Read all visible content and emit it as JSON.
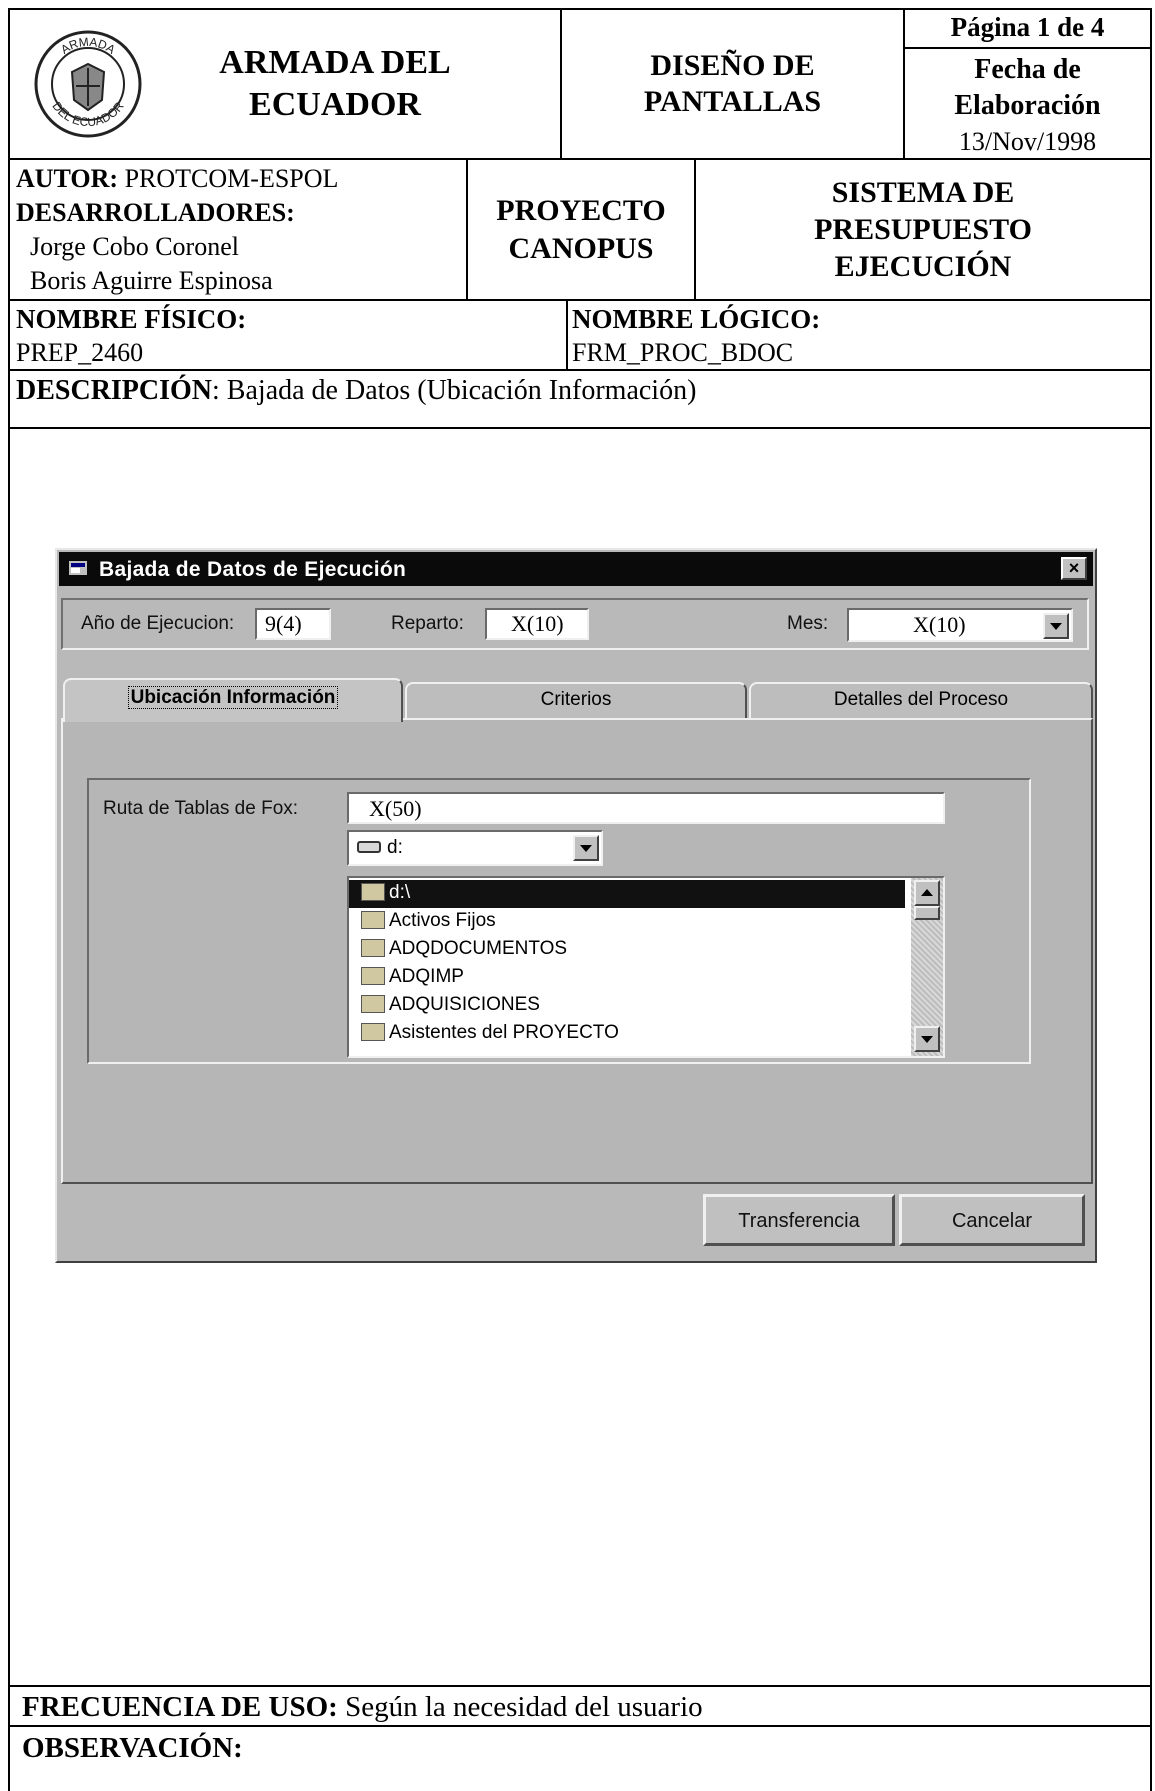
{
  "header": {
    "org_line1": "ARMADA DEL",
    "org_line2": "ECUADOR",
    "seal_top": "ARMADA",
    "seal_bottom": "DEL ECUADOR",
    "doc_type_line1": "DISEÑO DE",
    "doc_type_line2": "PANTALLAS",
    "page": "Página 1 de 4",
    "date_label_line1": "Fecha de",
    "date_label_line2": "Elaboración",
    "date": "13/Nov/1998"
  },
  "authors": {
    "author_label": "AUTOR:",
    "author": "PROTCOM-ESPOL",
    "dev_label": "DESARROLLADORES:",
    "dev1": "Jorge Cobo Coronel",
    "dev2": "Boris Aguirre Espinosa"
  },
  "project": {
    "line1": "PROYECTO",
    "line2": "CANOPUS"
  },
  "system": {
    "line1": "SISTEMA DE",
    "line2": "PRESUPUESTO",
    "line3": "EJECUCIÓN"
  },
  "names": {
    "physical_label": "NOMBRE FÍSICO:",
    "physical": "PREP_2460",
    "logical_label": "NOMBRE LÓGICO:",
    "logical": "FRM_PROC_BDOC"
  },
  "description": {
    "label": "DESCRIPCIÓN",
    "text": ": Bajada de Datos (Ubicación Información)"
  },
  "dialog": {
    "title": "Bajada de Datos de Ejecución",
    "close": "×",
    "year_label": "Año de Ejecucion:",
    "year_value": "9(4)",
    "reparto_label": "Reparto:",
    "reparto_value": "X(10)",
    "mes_label": "Mes:",
    "mes_value": "X(10)",
    "tabs": [
      "Ubicación Información",
      "Criterios",
      "Detalles del Proceso"
    ],
    "path_label": "Ruta de Tablas de Fox:",
    "path_value": "X(50)",
    "drive_value": "d:",
    "folders": [
      "d:\\",
      "Activos Fijos",
      "ADQDOCUMENTOS",
      "ADQIMP",
      "ADQUISICIONES",
      "Asistentes del PROYECTO"
    ],
    "transfer_button": "Transferencia",
    "cancel_button": "Cancelar"
  },
  "footer": {
    "freq_label": "FRECUENCIA DE USO:",
    "freq_value": "Según la necesidad del usuario",
    "obs_label": "OBSERVACIÓN:"
  }
}
